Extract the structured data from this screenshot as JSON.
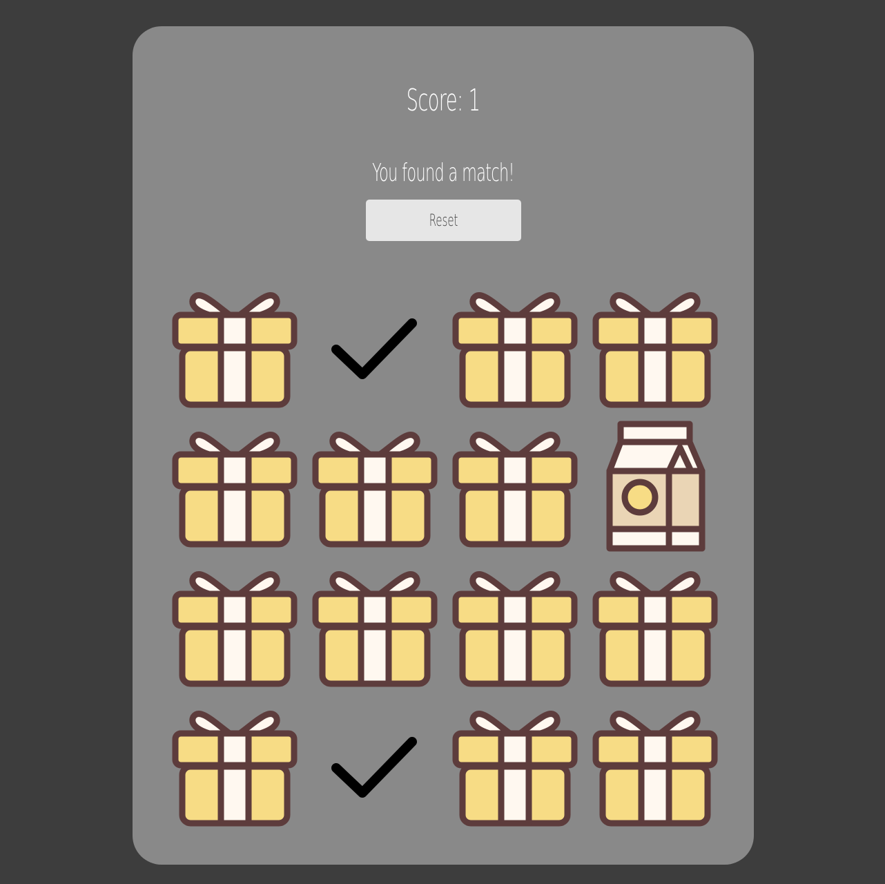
{
  "game": {
    "score_text": "Score: 1",
    "message": "You found a match!",
    "reset_label": "Reset"
  },
  "board": {
    "rows": 4,
    "cols": 4,
    "cards": [
      {
        "state": "hidden",
        "icon": "gift-icon"
      },
      {
        "state": "matched",
        "icon": "check-icon"
      },
      {
        "state": "hidden",
        "icon": "gift-icon"
      },
      {
        "state": "hidden",
        "icon": "gift-icon"
      },
      {
        "state": "hidden",
        "icon": "gift-icon"
      },
      {
        "state": "hidden",
        "icon": "gift-icon"
      },
      {
        "state": "hidden",
        "icon": "gift-icon"
      },
      {
        "state": "revealed",
        "icon": "milk-carton-icon"
      },
      {
        "state": "hidden",
        "icon": "gift-icon"
      },
      {
        "state": "hidden",
        "icon": "gift-icon"
      },
      {
        "state": "hidden",
        "icon": "gift-icon"
      },
      {
        "state": "hidden",
        "icon": "gift-icon"
      },
      {
        "state": "hidden",
        "icon": "gift-icon"
      },
      {
        "state": "matched",
        "icon": "check-icon"
      },
      {
        "state": "hidden",
        "icon": "gift-icon"
      },
      {
        "state": "hidden",
        "icon": "gift-icon"
      }
    ]
  },
  "colors": {
    "background": "#3d3d3d",
    "panel": "#898989",
    "gift_fill": "#f7dc85",
    "gift_ribbon": "#fff8f0",
    "outline": "#5d3c3c",
    "milk_side": "#ead5b5",
    "check": "#000000"
  }
}
